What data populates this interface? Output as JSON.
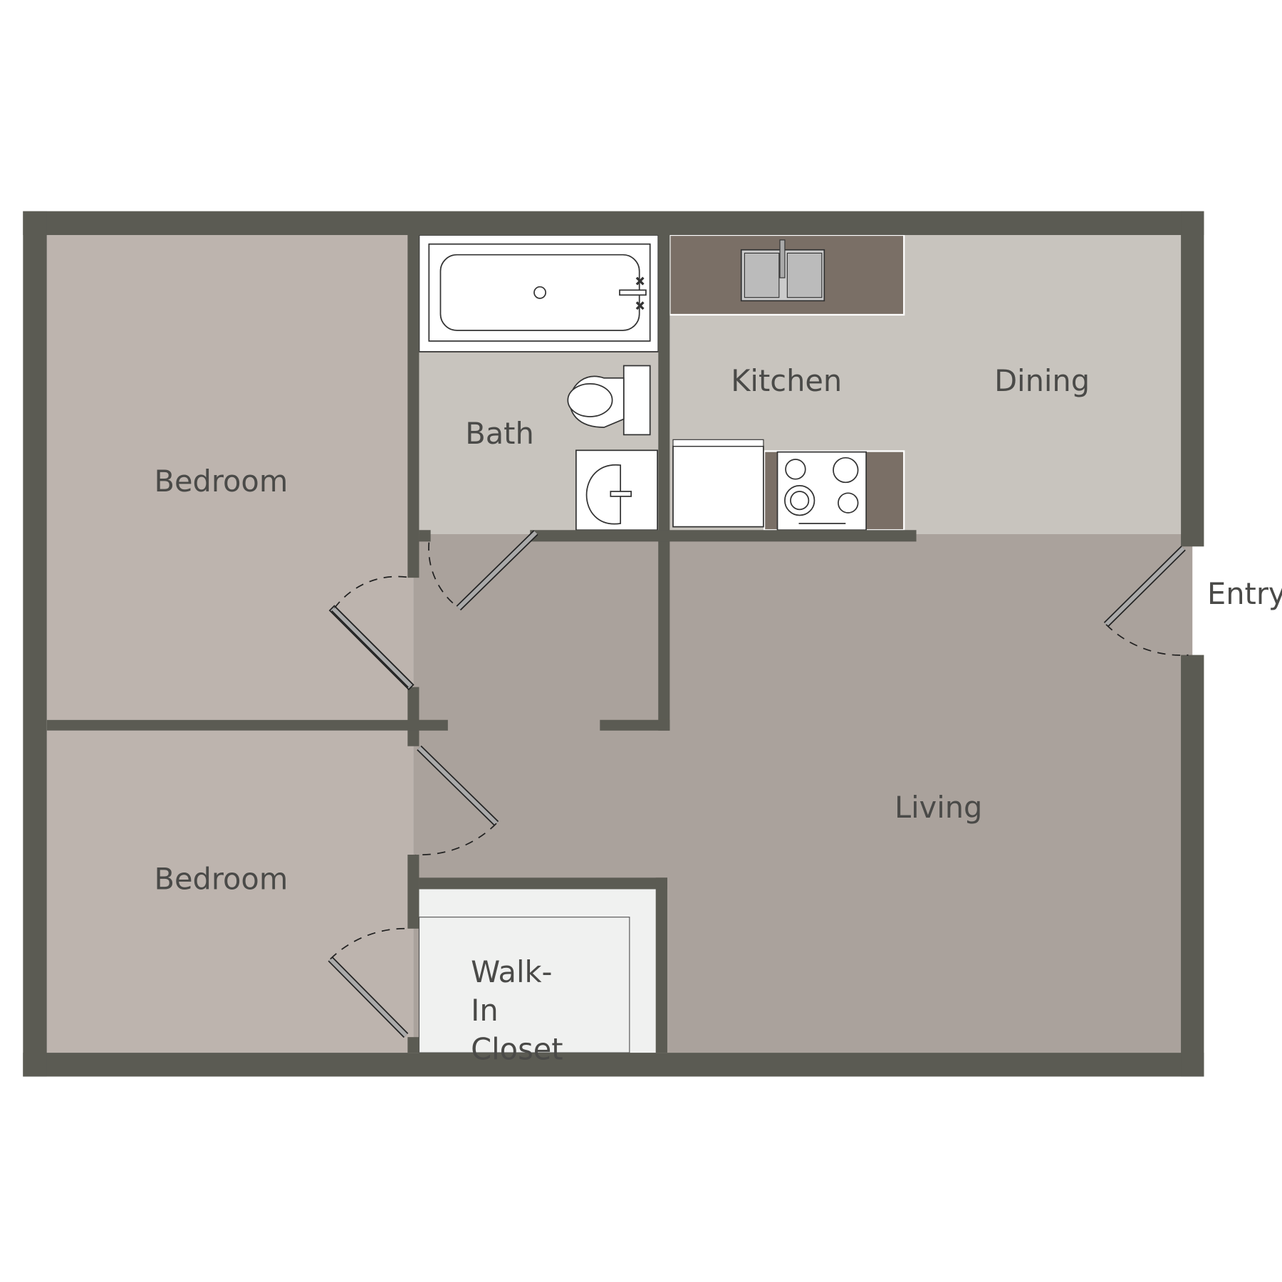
{
  "rooms": {
    "bedroom1": "Bedroom",
    "bedroom2": "Bedroom",
    "bath": "Bath",
    "kitchen": "Kitchen",
    "dining": "Dining",
    "living": "Living",
    "entry": "Entry",
    "closet_line1": "Walk-",
    "closet_line2": "In",
    "closet_line3": "Closet"
  },
  "colors": {
    "wall": "#5b5b53",
    "bedroom": "#bdb4ae",
    "wet_area": "#c8c4be",
    "living": "#aaa29c",
    "counter": "#7a6f66",
    "closet": "#f0f1f0"
  }
}
